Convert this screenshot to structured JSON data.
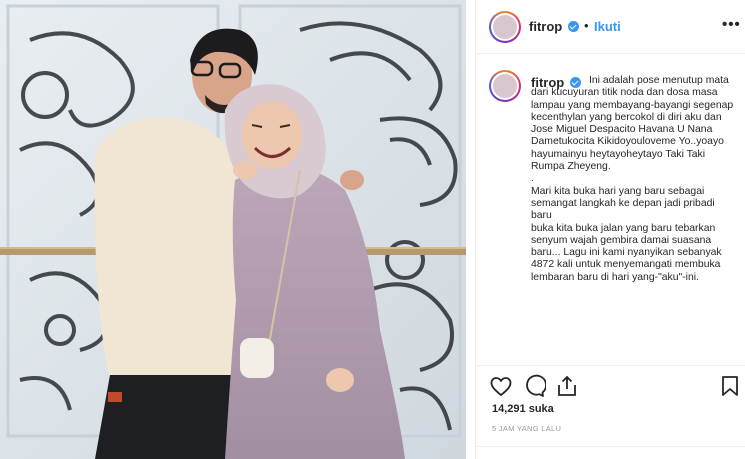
{
  "header": {
    "username": "fitrop",
    "separator": "•",
    "follow_label": "Ikuti",
    "more_label": "•••"
  },
  "caption": {
    "username": "fitrop",
    "text": "Ini adalah pose menutup mata dari kucuyuran titik noda dan dosa masa lampau yang membayang-bayangi segenap kecenthylan yang bercokol di diri aku dan Jose Miguel Despacito Havana U Nana Dametukocita Kikidoyouloveme Yo..yoayo hayumainyu heytayoheytayo Taki Taki Rumpa Zheyeng.\n.\nMari kita buka hari yang baru sebagai semangat langkah ke depan jadi pribadi baru\nbuka kita buka jalan yang baru tebarkan senyum wajah gembira damai suasana baru... Lagu ini kami nyanyikan sebanyak 4872 kali untuk menyemangati membuka lembaran baru di hari yang-\"aku\"-ini."
  },
  "stats": {
    "likes": "14,291 suka",
    "time": "5 JAM YANG LALU"
  },
  "icons": {
    "like": "heart-icon",
    "comment": "comment-icon",
    "share": "share-icon",
    "save": "bookmark-icon",
    "verified": "verified-badge-icon",
    "more": "more-options-icon"
  },
  "colors": {
    "link": "#3897f0",
    "text": "#262626",
    "muted": "#999999",
    "border": "#efefef"
  }
}
